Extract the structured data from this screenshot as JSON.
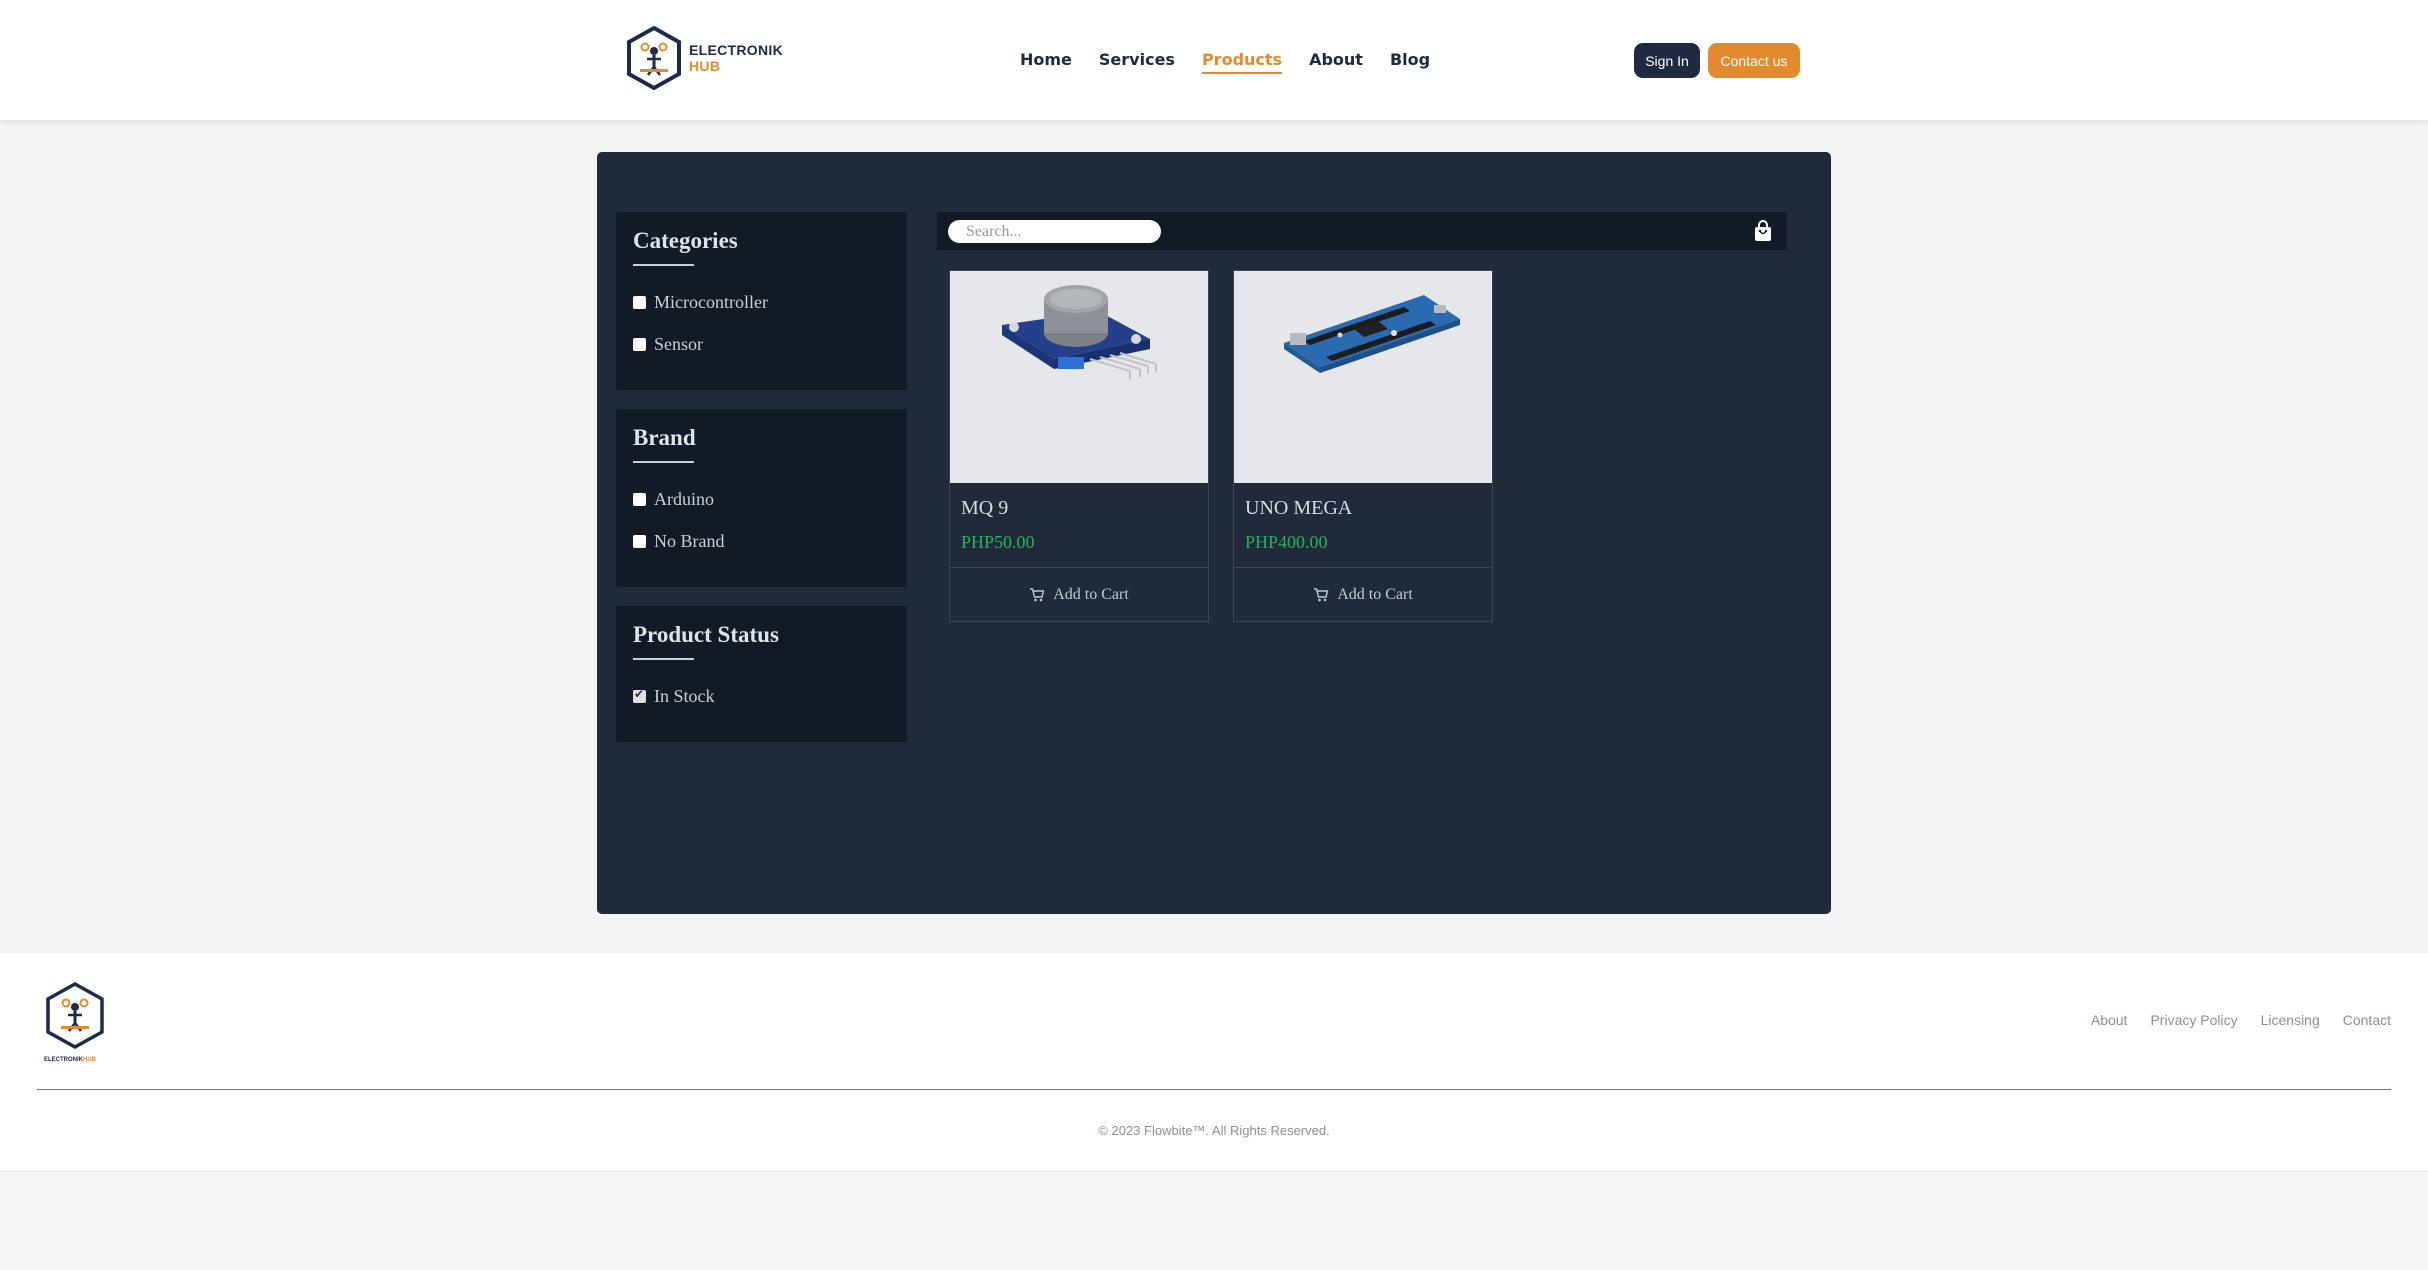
{
  "header": {
    "logo": {
      "line1": "ELECTRONIK",
      "line2": "HUB"
    },
    "nav": [
      {
        "label": "Home",
        "active": false
      },
      {
        "label": "Services",
        "active": false
      },
      {
        "label": "Products",
        "active": true
      },
      {
        "label": "About",
        "active": false
      },
      {
        "label": "Blog",
        "active": false
      }
    ],
    "sign_in_label": "Sign In",
    "contact_label": "Contact us"
  },
  "filters": {
    "categories": {
      "title": "Categories",
      "options": [
        {
          "label": "Microcontroller",
          "checked": false
        },
        {
          "label": "Sensor",
          "checked": false
        }
      ]
    },
    "brand": {
      "title": "Brand",
      "options": [
        {
          "label": "Arduino",
          "checked": false
        },
        {
          "label": "No Brand",
          "checked": false
        }
      ]
    },
    "status": {
      "title": "Product Status",
      "options": [
        {
          "label": "In Stock",
          "checked": true
        }
      ]
    }
  },
  "search": {
    "placeholder": "Search...",
    "value": ""
  },
  "cart_icon": "shopping-bag-icon",
  "products": [
    {
      "name": "MQ 9",
      "price": "PHP50.00",
      "cart_label": "Add to Cart",
      "image": "gas-sensor-module"
    },
    {
      "name": "UNO MEGA",
      "price": "PHP400.00",
      "cart_label": "Add to Cart",
      "image": "arduino-board"
    }
  ],
  "footer": {
    "logo_text": {
      "line1": "ELECTRONIK",
      "line2": "HUB"
    },
    "links": [
      "About",
      "Privacy Policy",
      "Licensing",
      "Contact"
    ],
    "copyright": "© 2023 Flowbite™. All Rights Reserved."
  },
  "colors": {
    "brand_orange": "#e38b2c",
    "brand_navy": "#1e2a40",
    "panel": "#212a3b",
    "filter_box": "#121a28",
    "price_green": "#22b45a"
  }
}
